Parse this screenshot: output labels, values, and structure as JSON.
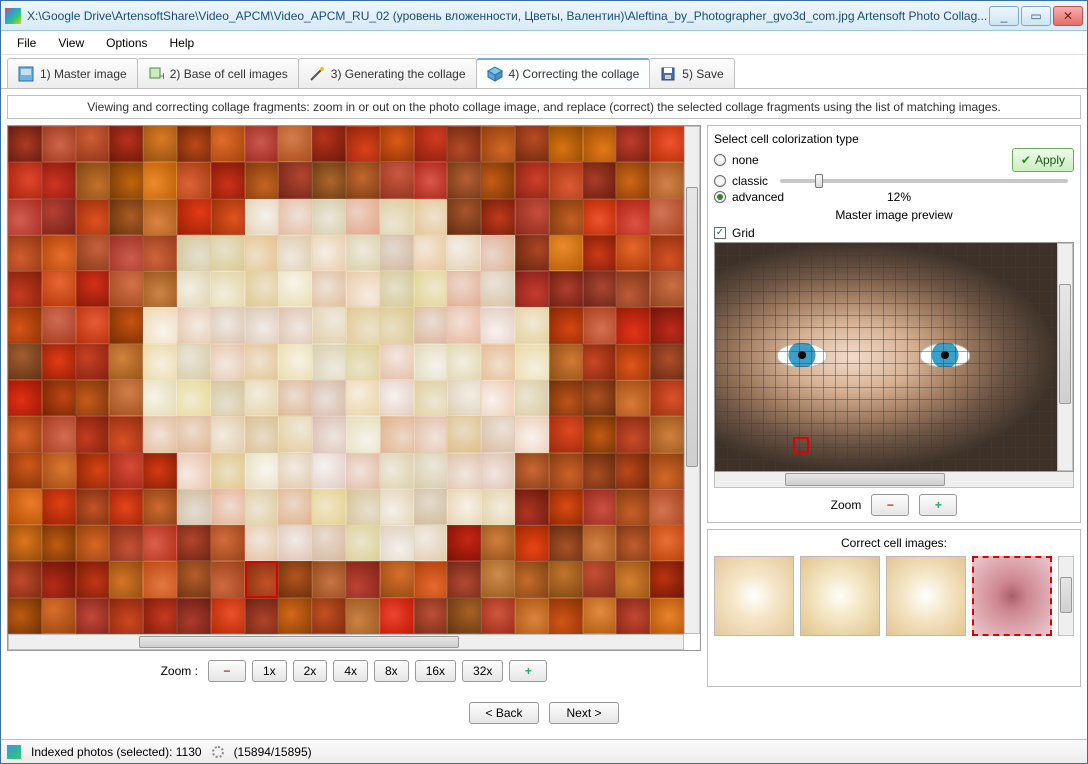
{
  "window": {
    "title": "X:\\Google Drive\\ArtensoftShare\\Video_APCM\\Video_APCM_RU_02 (уровень вложенности, Цветы, Валентин)\\Aleftina_by_Photographer_gvo3d_com.jpg Artensoft Photo Collag...",
    "min": "_",
    "max": "▭",
    "close": "✕"
  },
  "menu": {
    "file": "File",
    "view": "View",
    "options": "Options",
    "help": "Help"
  },
  "tabs": {
    "t1": "1) Master image",
    "t2": "2) Base of cell images",
    "t3": "3) Generating the collage",
    "t4": "4) Correcting the collage",
    "t5": "5) Save"
  },
  "hint": "Viewing and correcting collage fragments: zoom in or out on the photo collage image, and replace (correct) the selected collage fragments using the list of matching images.",
  "zoom": {
    "label": "Zoom   :",
    "b1": "1x",
    "b2": "2x",
    "b4": "4x",
    "b8": "8x",
    "b16": "16x",
    "b32": "32x"
  },
  "color": {
    "header": "Select cell colorization type",
    "none": "none",
    "classic": "classic",
    "advanced": "advanced",
    "percent": "12%",
    "apply": "Apply"
  },
  "preview": {
    "header": "Master image preview",
    "grid": "Grid",
    "zoom_label": "Zoom"
  },
  "correct": {
    "header": "Correct cell images:"
  },
  "nav": {
    "back": "< Back",
    "next": "Next >"
  },
  "status": {
    "indexed": "Indexed photos (selected): 1130",
    "progress": "(15894/15895)"
  },
  "icons": {
    "minus": "−",
    "plus": "+"
  }
}
